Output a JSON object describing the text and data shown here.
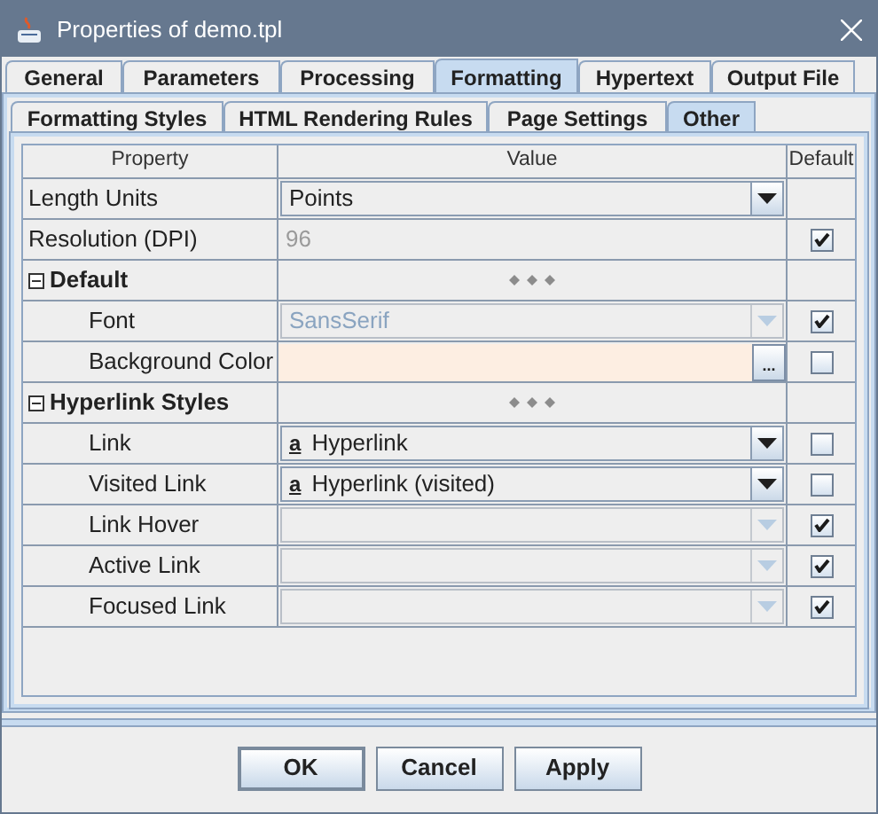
{
  "window": {
    "title": "Properties of demo.tpl"
  },
  "tabs": [
    {
      "label": "General",
      "selected": false
    },
    {
      "label": "Parameters",
      "selected": false
    },
    {
      "label": "Processing",
      "selected": false
    },
    {
      "label": "Formatting",
      "selected": true
    },
    {
      "label": "Hypertext",
      "selected": false
    },
    {
      "label": "Output File",
      "selected": false
    }
  ],
  "subtabs": [
    {
      "label": "Formatting Styles",
      "selected": false
    },
    {
      "label": "HTML Rendering Rules",
      "selected": false
    },
    {
      "label": "Page Settings",
      "selected": false
    },
    {
      "label": "Other",
      "selected": true
    }
  ],
  "table": {
    "columns": [
      "Property",
      "Value",
      "Default"
    ],
    "rows": [
      {
        "kind": "combo",
        "label": "Length Units",
        "value": "Points",
        "disabled": false
      },
      {
        "kind": "readonly",
        "label": "Resolution (DPI)",
        "value": "96",
        "default": true
      },
      {
        "kind": "group",
        "label": "Default",
        "expanded": true,
        "children": [
          {
            "kind": "combo",
            "label": "Font",
            "value": "SansSerif",
            "disabled": true,
            "default": true
          },
          {
            "kind": "color",
            "label": "Background Color",
            "color": "#fdeee2",
            "button": "...",
            "default": false
          }
        ]
      },
      {
        "kind": "group",
        "label": "Hyperlink Styles",
        "expanded": true,
        "children": [
          {
            "kind": "combo",
            "label": "Link",
            "style_icon": "a",
            "value": "Hyperlink",
            "disabled": false,
            "default": false
          },
          {
            "kind": "combo",
            "label": "Visited Link",
            "style_icon": "a",
            "value": "Hyperlink (visited)",
            "disabled": false,
            "default": false
          },
          {
            "kind": "combo",
            "label": "Link Hover",
            "disabled": true,
            "default": true
          },
          {
            "kind": "combo",
            "label": "Active Link",
            "disabled": true,
            "default": true
          },
          {
            "kind": "combo",
            "label": "Focused Link",
            "disabled": true,
            "default": true
          }
        ]
      }
    ]
  },
  "buttons": [
    {
      "label": "OK",
      "default": true
    },
    {
      "label": "Cancel",
      "default": false
    },
    {
      "label": "Apply",
      "default": false
    }
  ]
}
